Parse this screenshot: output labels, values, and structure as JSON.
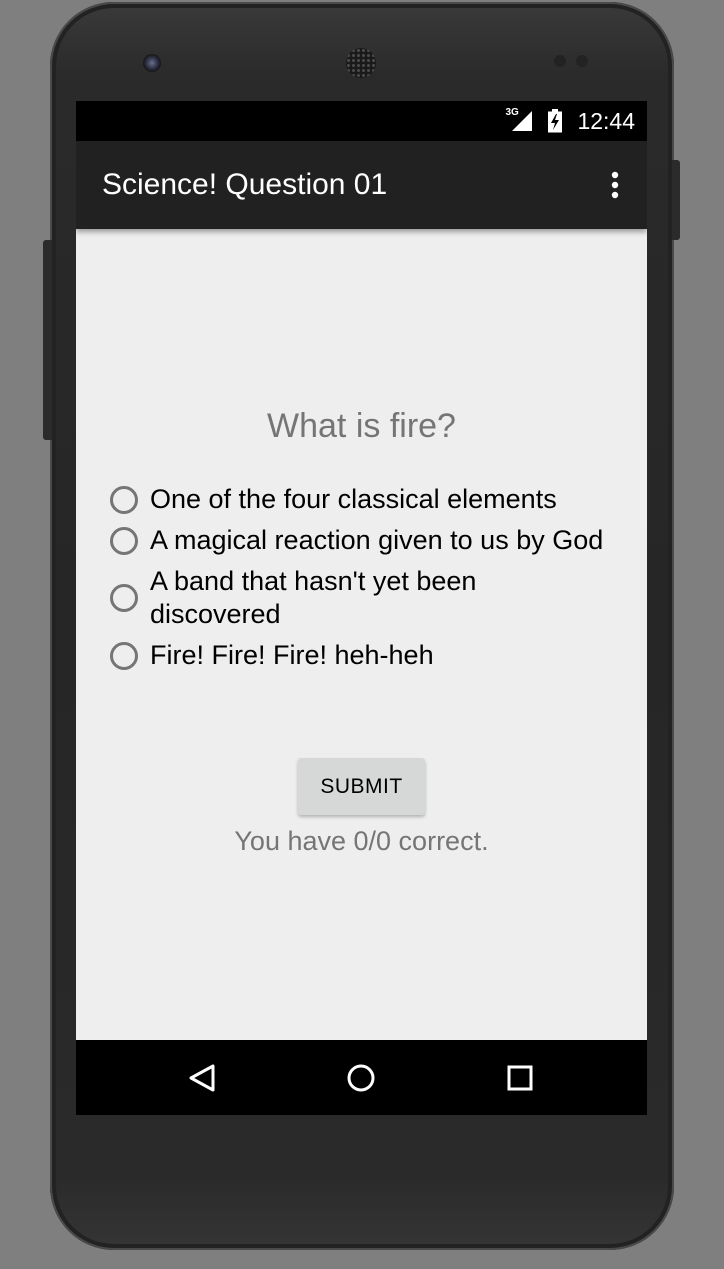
{
  "status_bar": {
    "network_label": "3G",
    "time": "12:44"
  },
  "action_bar": {
    "title": "Science! Question 01",
    "overflow_icon": "more-vert-icon"
  },
  "quiz": {
    "question": "What is fire?",
    "options": [
      {
        "label": "One of the four classical elements",
        "selected": false
      },
      {
        "label": "A magical reaction given to us by God",
        "selected": false
      },
      {
        "label": "A band that hasn't yet been discovered",
        "selected": false
      },
      {
        "label": "Fire! Fire! Fire! heh-heh",
        "selected": false
      }
    ],
    "submit_label": "SUBMIT",
    "score_text": "You have 0/0 correct."
  },
  "navigation": {
    "back_icon": "back-icon",
    "home_icon": "home-icon",
    "recents_icon": "recents-icon"
  },
  "colors": {
    "action_bar": "#212121",
    "content_background": "#eeeeee",
    "secondary_text": "#757575",
    "button_background": "#d6d7d7"
  }
}
